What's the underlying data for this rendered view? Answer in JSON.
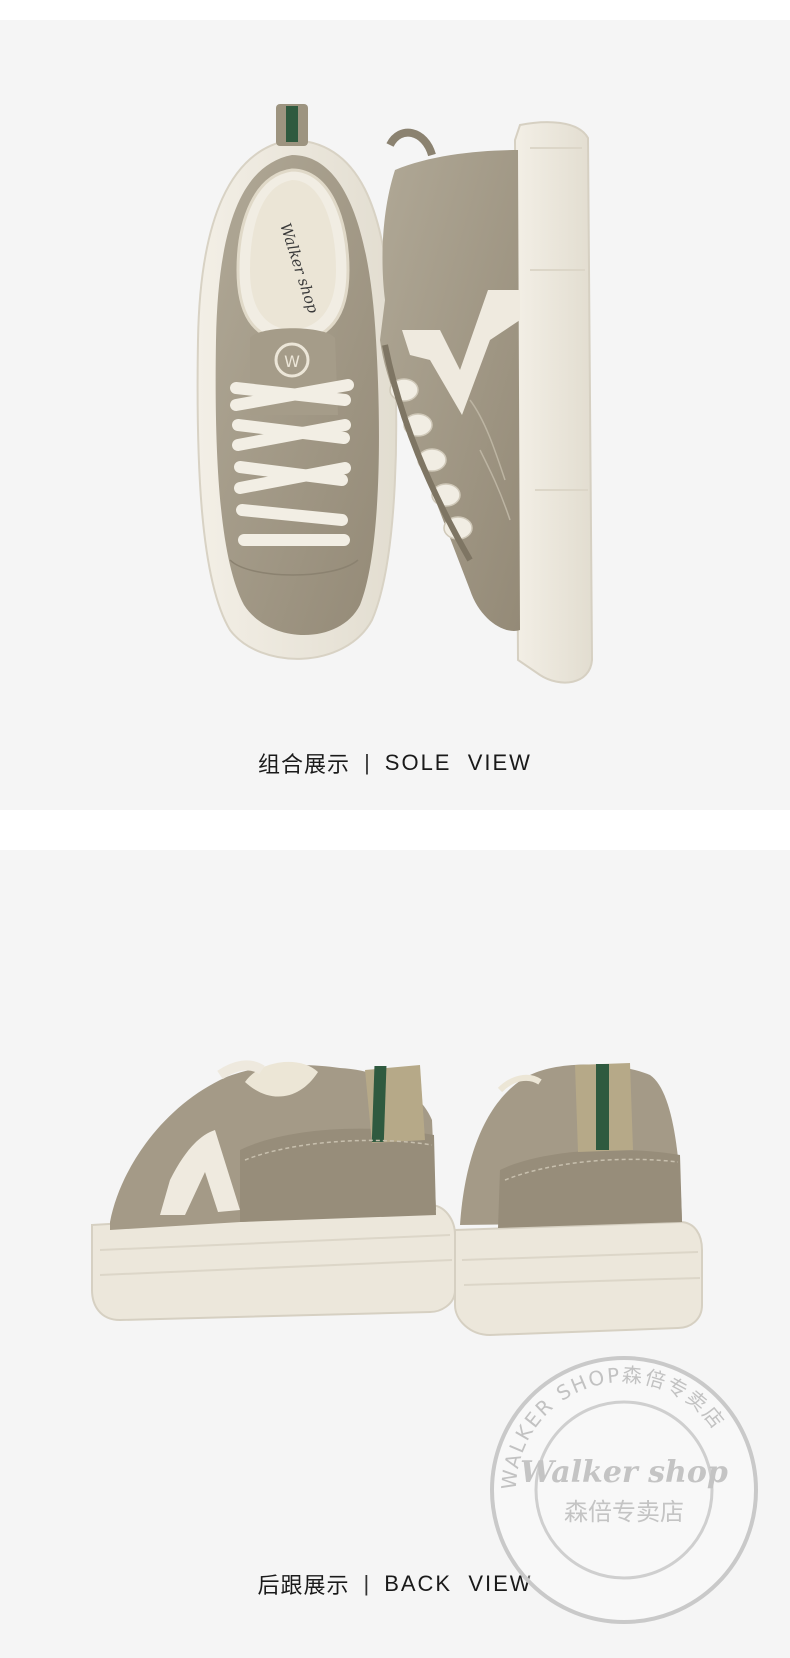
{
  "top_section": {
    "caption_cn": "组合展示",
    "caption_separator": "|",
    "caption_en": "SOLE  VIEW",
    "insole_print": "Walker shop"
  },
  "bottom_section": {
    "caption_cn": "后跟展示",
    "caption_separator": "|",
    "caption_en": "BACK  VIEW"
  },
  "watermark": {
    "ring_text": "WALKER SHOP森倍专卖店",
    "brand_text": "Walker shop",
    "store_text": "森倍专卖店"
  },
  "colors": {
    "background": "#f5f5f5",
    "shoe_taupe": "#a09684",
    "sole_cream": "#ede8dc",
    "stripe_green": "#2f5a3f"
  }
}
